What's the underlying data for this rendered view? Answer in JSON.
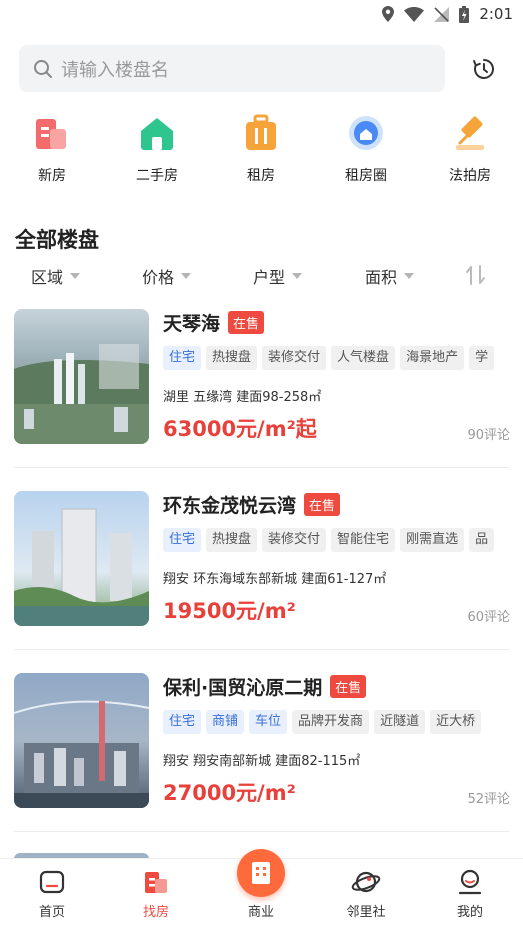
{
  "status": {
    "time": "2:01"
  },
  "search": {
    "placeholder": "请输入楼盘名"
  },
  "quicknav": [
    {
      "label": "新房",
      "icon": "new-house-icon"
    },
    {
      "label": "二手房",
      "icon": "second-hand-icon"
    },
    {
      "label": "租房",
      "icon": "rent-icon"
    },
    {
      "label": "租房圈",
      "icon": "rent-circle-icon"
    },
    {
      "label": "法拍房",
      "icon": "auction-icon"
    }
  ],
  "section_title": "全部楼盘",
  "filters": [
    "区域",
    "价格",
    "户型",
    "面积"
  ],
  "listings": [
    {
      "name": "天琴海",
      "badge": "在售",
      "tags": [
        "住宅",
        "热搜盘",
        "装修交付",
        "人气楼盘",
        "海景地产",
        "学"
      ],
      "location": "湖里  五缘湾 建面98-258㎡",
      "price": "63000元/m²起",
      "comments": "90评论"
    },
    {
      "name": "环东金茂悦云湾",
      "badge": "在售",
      "tags": [
        "住宅",
        "热搜盘",
        "装修交付",
        "智能住宅",
        "刚需直选",
        "品"
      ],
      "location": "翔安  环东海域东部新城 建面61-127㎡",
      "price": "19500元/m²",
      "comments": "60评论"
    },
    {
      "name": "保利·国贸沁原二期",
      "badge": "在售",
      "tags": [
        "住宅",
        "商铺",
        "车位",
        "品牌开发商",
        "近隧道",
        "近大桥"
      ],
      "location": "翔安  翔安南部新城 建面82-115㎡",
      "price": "27000元/m²",
      "comments": "52评论"
    }
  ],
  "tabbar": [
    {
      "label": "首页",
      "icon": "home-icon"
    },
    {
      "label": "找房",
      "icon": "find-house-icon"
    },
    {
      "label": "商业",
      "icon": "business-icon"
    },
    {
      "label": "邻里社",
      "icon": "neighborhood-icon"
    },
    {
      "label": "我的",
      "icon": "profile-icon"
    }
  ],
  "colors": {
    "accent": "#ee4a3f",
    "tag_blue": "#3a6fd8",
    "search_bg": "#f2f3f5"
  }
}
